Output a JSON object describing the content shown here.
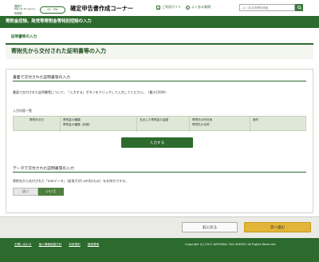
{
  "header": {
    "logo_lines": [
      "国税庁",
      "National Tax Agency",
      "所得税"
    ],
    "pc_badge": "ID・PW",
    "app_title": "確定申告書作成コーナー",
    "links": [
      {
        "label": "ご利用ガイド",
        "icon": "guide-icon"
      },
      {
        "label": "よくある質問",
        "icon": "faq-icon"
      }
    ],
    "search_placeholder": "よくある質問を検索"
  },
  "green_bar": {
    "title": "寄附金控除、政党等寄附金等特別控除の入力"
  },
  "breadcrumb": "証明書等の入力",
  "section": {
    "title": "寄附先から交付された証明書等の入力"
  },
  "paper_section": {
    "title": "書面で交付された証明書等の入力",
    "description": "書面で交付された証明書等について、「入力する」ボタンをクリックして入力してください。（最大150件）",
    "list_label": "入力内容一覧",
    "columns": [
      {
        "lines": [
          "寄附年月日",
          ""
        ]
      },
      {
        "lines": [
          "寄附金の種類",
          "寄附金の種類（詳細）"
        ]
      },
      {
        "lines": [
          "支出した寄附金の金額",
          ""
        ]
      },
      {
        "lines": [
          "寄附先の所在地",
          "寄附先の名称"
        ]
      },
      {
        "lines": [
          "操作",
          ""
        ]
      }
    ],
    "input_button": "入力する"
  },
  "data_section": {
    "title": "データで交付された証明書等の入力",
    "description": "寄附先から交付された「xmlデータ」（拡張子が[.xml]のもの）をお持ちですか。",
    "yes": "はい",
    "no": "いいえ",
    "selected": "いいえ"
  },
  "actions": {
    "back": "前に戻る",
    "next": "次へ進む"
  },
  "footer": {
    "links": [
      "お問い合わせ",
      "個人情報保護方針",
      "利用規約",
      "推奨環境"
    ],
    "copyright": "Copyright (C) 2021 NATIONAL TAX AGENCY All Rights Reserved."
  },
  "colors": {
    "brand_green": "#2d6a2d",
    "next_button": "#e2b538",
    "selected_option": "#4f7f3f"
  }
}
